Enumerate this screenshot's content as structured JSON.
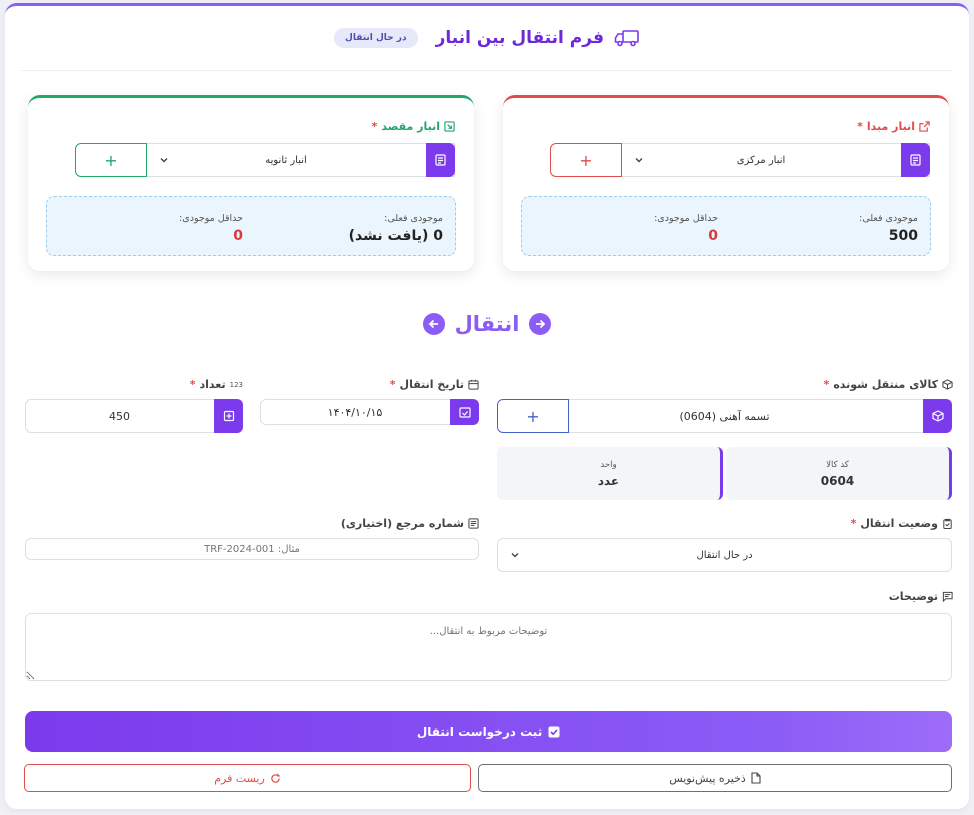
{
  "header": {
    "title": "فرم انتقال بین انبار",
    "status_badge": "در حال انتقال"
  },
  "source": {
    "label": "انبار مبدا",
    "selected": "انبار مرکزی",
    "plus": "+",
    "current_stock_label": "موجودی فعلی:",
    "current_stock_value": "500",
    "min_stock_label": "حداقل موجودی:",
    "min_stock_value": "0"
  },
  "destination": {
    "label": "انبار مقصد",
    "selected": "انبار ثانویه",
    "plus": "+",
    "current_stock_label": "موجودی فعلی:",
    "current_stock_value": "0 (یافت نشد)",
    "min_stock_label": "حداقل موجودی:",
    "min_stock_value": "0"
  },
  "transfer_label": "انتقال",
  "required_mark": "*",
  "product": {
    "label": "کالای منتقل شونده",
    "selected": "تسمه آهنی (0604)",
    "plus": "+",
    "code_label": "کد کالا",
    "code_value": "0604",
    "unit_label": "واحد",
    "unit_value": "عدد"
  },
  "date": {
    "label": "تاریخ انتقال",
    "value": "۱۴۰۴/۱۰/۱۵"
  },
  "quantity": {
    "label": "تعداد",
    "icon_text": "123",
    "value": "450"
  },
  "status": {
    "label": "وضعیت انتقال",
    "selected": "در حال انتقال"
  },
  "reference": {
    "label": "شماره مرجع (اختیاری)",
    "placeholder": "مثال: TRF-2024-001"
  },
  "notes": {
    "label": "توضیحات",
    "placeholder": "توضیحات مربوط به انتقال..."
  },
  "buttons": {
    "submit": "ثبت درخواست انتقال",
    "draft": "ذخیره پیش‌نویس",
    "reset": "ریست فرم"
  },
  "colors": {
    "primary": "#7c3aed",
    "danger": "#e04b4b",
    "success": "#22a76b",
    "info_bg": "#eaf5fd"
  }
}
